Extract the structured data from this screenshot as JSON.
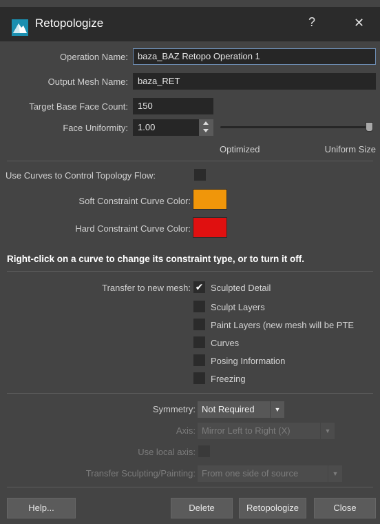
{
  "window": {
    "title": "Retopologize",
    "help_glyph": "?",
    "close_glyph": "✕",
    "icon": "retopo-app-icon"
  },
  "form": {
    "operation_name_label": "Operation Name:",
    "operation_name_value": "baza_BAZ Retopo Operation 1",
    "output_mesh_label": "Output Mesh Name:",
    "output_mesh_value": "baza_RET",
    "target_face_label": "Target Base Face Count:",
    "target_face_value": "150",
    "uniformity_label": "Face Uniformity:",
    "uniformity_value": "1.00",
    "uniformity_level": 1.0,
    "slider_left_label": "Optimized",
    "slider_right_label": "Uniform Size"
  },
  "curves": {
    "use_curves_label": "Use Curves to Control Topology Flow:",
    "use_curves_checked": false,
    "soft_label": "Soft Constraint Curve Color:",
    "soft_color": "#f0960a",
    "hard_label": "Hard Constraint Curve Color:",
    "hard_color": "#e01010",
    "hint": "Right-click on a curve to change its constraint type, or to turn it off."
  },
  "transfer": {
    "label": "Transfer to new mesh:",
    "check_glyph": "✔",
    "items": [
      {
        "label": "Sculpted Detail",
        "checked": true
      },
      {
        "label": "Sculpt Layers",
        "checked": false
      },
      {
        "label": "Paint Layers (new mesh will be PTE",
        "checked": false
      },
      {
        "label": "Curves",
        "checked": false
      },
      {
        "label": "Posing Information",
        "checked": false
      },
      {
        "label": "Freezing",
        "checked": false
      }
    ]
  },
  "symmetry": {
    "symmetry_label": "Symmetry:",
    "symmetry_value": "Not Required",
    "axis_label": "Axis:",
    "axis_value": "Mirror Left to Right (X)",
    "local_axis_label": "Use local axis:",
    "transfer_label": "Transfer Sculpting/Painting:",
    "transfer_value": "From one side of source",
    "dropdown_glyph": "▼"
  },
  "buttons": {
    "help": "Help...",
    "delete": "Delete",
    "retopologize": "Retopologize",
    "close": "Close"
  }
}
